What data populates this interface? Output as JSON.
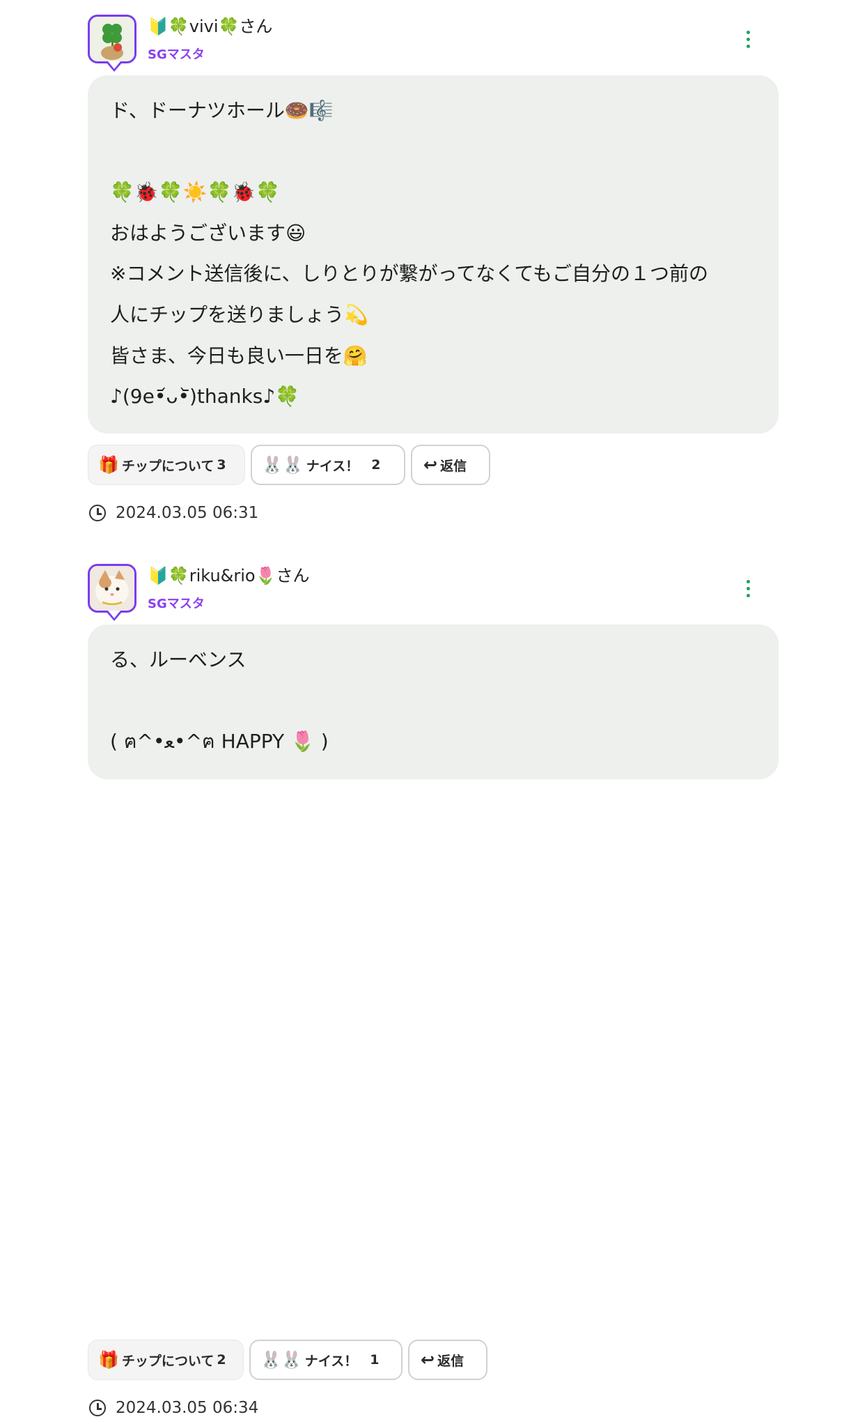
{
  "colors": {
    "accent": "#8b3ff0",
    "menu_dots": "#1ea35a",
    "bubble": "#edf0ed"
  },
  "posts": [
    {
      "name": "🔰🍀vivi🍀さん",
      "role": "SGマスタ",
      "lines": [
        "ド、ドーナツホール🍩🎼",
        "",
        "🍀🐞🍀☀️🍀🐞🍀",
        "おはようございます😃",
        "※コメント送信後に、しりとりが繋がってなくてもご自分の１つ前の",
        "人にチップを送りましょう💫",
        "皆さま、今日も良い一日を🤗",
        "♪(9e•᷄ᴗ•᷅)thanks♪🍀"
      ],
      "tip_label": "チップについて",
      "tip_count": "3",
      "nice_label": "ナイス！",
      "nice_count": "2",
      "reply_label": "返信",
      "timestamp": "2024.03.05 06:31"
    },
    {
      "name": "🔰🍀riku&rio🌷さん",
      "role": "SGマスタ",
      "lines": [
        "る、ルーベンス",
        "",
        "( ฅ^•ﻌ•^ฅ HAPPY 🌷 )"
      ],
      "tip_label": "チップについて",
      "tip_count": "2",
      "nice_label": "ナイス！",
      "nice_count": "1",
      "reply_label": "返信",
      "timestamp": "2024.03.05 06:34"
    }
  ]
}
